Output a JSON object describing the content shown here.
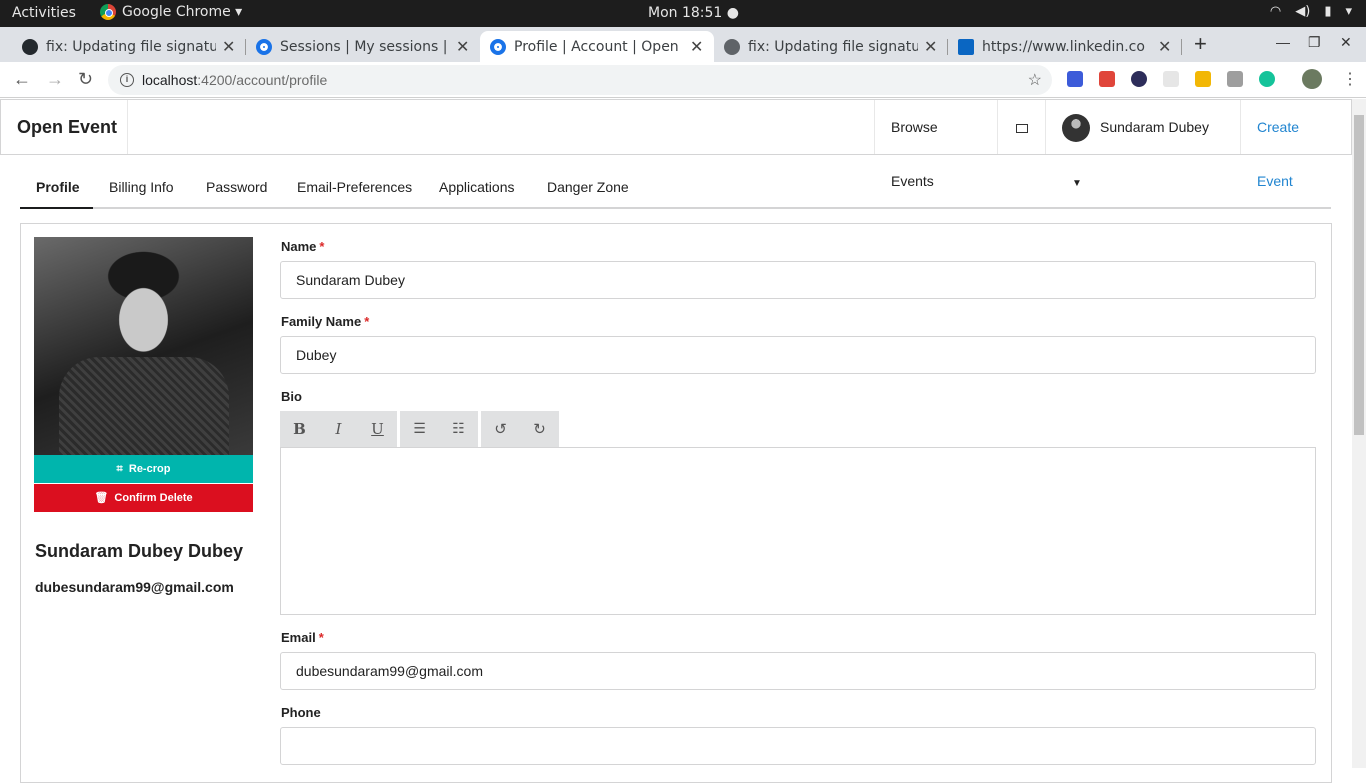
{
  "system": {
    "activities": "Activities",
    "app_menu": "Google Chrome ▾",
    "clock": "Mon 18:51 ●",
    "tray": [
      "wifi",
      "volume",
      "battery",
      "▾"
    ]
  },
  "browser": {
    "tabs": [
      {
        "title": "fix: Updating file signatu",
        "icon": "github-icon",
        "color": "#24292e"
      },
      {
        "title": "Sessions | My sessions | O",
        "icon": "openevent-icon",
        "color": "#1a73e8"
      },
      {
        "title": "Profile | Account | Open E",
        "icon": "openevent-icon",
        "color": "#1a73e8",
        "active": true
      },
      {
        "title": "fix: Updating file signatu",
        "icon": "globe-icon",
        "color": "#5f6368"
      },
      {
        "title": "https://www.linkedin.co",
        "icon": "linkedin-icon",
        "color": "#0a66c2"
      }
    ],
    "url_host": "localhost",
    "url_path": ":4200/account/profile"
  },
  "app": {
    "brand": "Open Event",
    "nav": {
      "browse": "Browse Events",
      "user": "Sundaram Dubey",
      "create": "Create Event"
    },
    "tabs": [
      "Profile",
      "Billing Info",
      "Password",
      "Email-Preferences",
      "Applications",
      "Danger Zone"
    ],
    "sidebar": {
      "recrop": "Re-crop",
      "confirm_delete": "Confirm Delete",
      "full_name": "Sundaram Dubey Dubey",
      "email": "dubesundaram99@gmail.com"
    },
    "form": {
      "name_label": "Name",
      "name_value": "Sundaram Dubey",
      "family_label": "Family Name",
      "family_value": "Dubey",
      "bio_label": "Bio",
      "email_label": "Email",
      "email_value": "dubesundaram99@gmail.com",
      "phone_label": "Phone",
      "phone_value": "",
      "required_mark": "*"
    },
    "colors": {
      "accent_teal": "#00b5ad",
      "danger_red": "#db0f1f",
      "link_blue": "#2185d0"
    }
  }
}
